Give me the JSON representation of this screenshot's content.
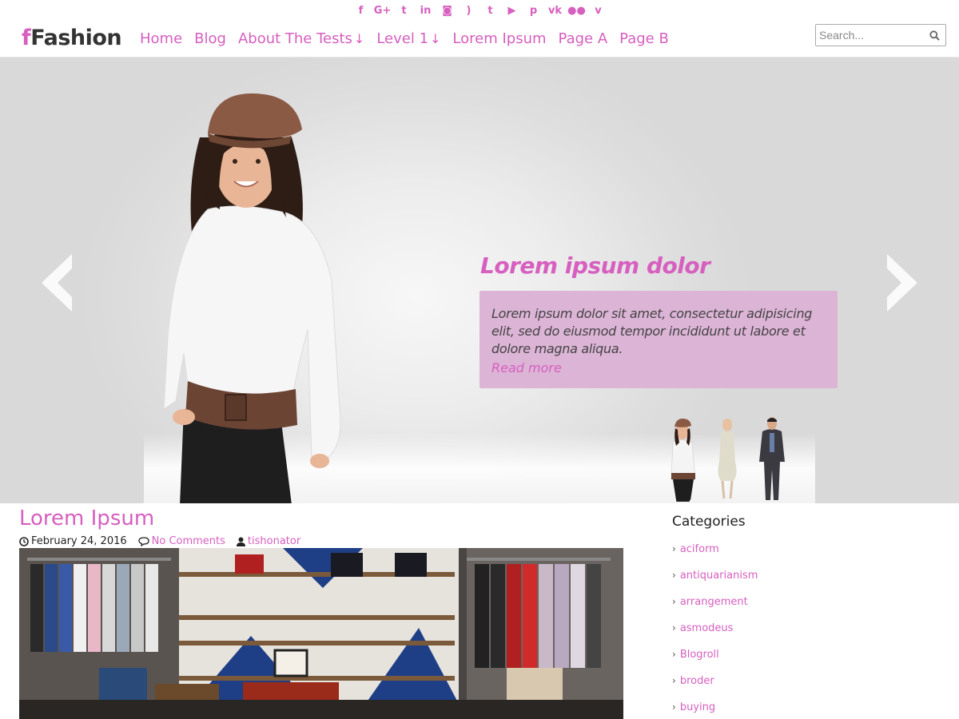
{
  "colors": {
    "accent": "#d65fbf",
    "caption_bg": "#dcb4d6",
    "text": "#222222"
  },
  "social": [
    {
      "name": "facebook-icon",
      "glyph": "f"
    },
    {
      "name": "google-plus-icon",
      "glyph": "G+"
    },
    {
      "name": "twitter-icon",
      "glyph": "t"
    },
    {
      "name": "linkedin-icon",
      "glyph": "in"
    },
    {
      "name": "instagram-icon",
      "glyph": "◙"
    },
    {
      "name": "rss-icon",
      "glyph": ")"
    },
    {
      "name": "tumblr-icon",
      "glyph": "t"
    },
    {
      "name": "youtube-icon",
      "glyph": "▶"
    },
    {
      "name": "pinterest-icon",
      "glyph": "p"
    },
    {
      "name": "vk-icon",
      "glyph": "vk"
    },
    {
      "name": "flickr-icon",
      "glyph": "●●"
    },
    {
      "name": "vine-icon",
      "glyph": "v"
    }
  ],
  "header": {
    "logo_first": "f",
    "logo_rest": "Fashion",
    "nav": [
      {
        "label": "Home",
        "arrow": ""
      },
      {
        "label": "Blog",
        "arrow": ""
      },
      {
        "label": "About The Tests",
        "arrow": "↓"
      },
      {
        "label": "Level 1",
        "arrow": "↓"
      },
      {
        "label": "Lorem Ipsum",
        "arrow": ""
      },
      {
        "label": "Page A",
        "arrow": ""
      },
      {
        "label": "Page B",
        "arrow": ""
      }
    ],
    "search_placeholder": "Search..."
  },
  "slider": {
    "caption_title": "Lorem ipsum dolor",
    "caption_text": "Lorem ipsum dolor sit amet, consectetur adipisicing elit, sed do eiusmod tempor incididunt ut labore et dolore magna aliqua.",
    "read_more": "Read more",
    "active_slide": 1,
    "slide_count": 3
  },
  "post": {
    "title": "Lorem Ipsum",
    "date": "February 24, 2016",
    "comments": "No Comments",
    "author": "tishonator"
  },
  "sidebar": {
    "heading": "Categories",
    "categories": [
      "aciform",
      "antiquarianism",
      "arrangement",
      "asmodeus",
      "Blogroll",
      "broder",
      "buying"
    ]
  }
}
